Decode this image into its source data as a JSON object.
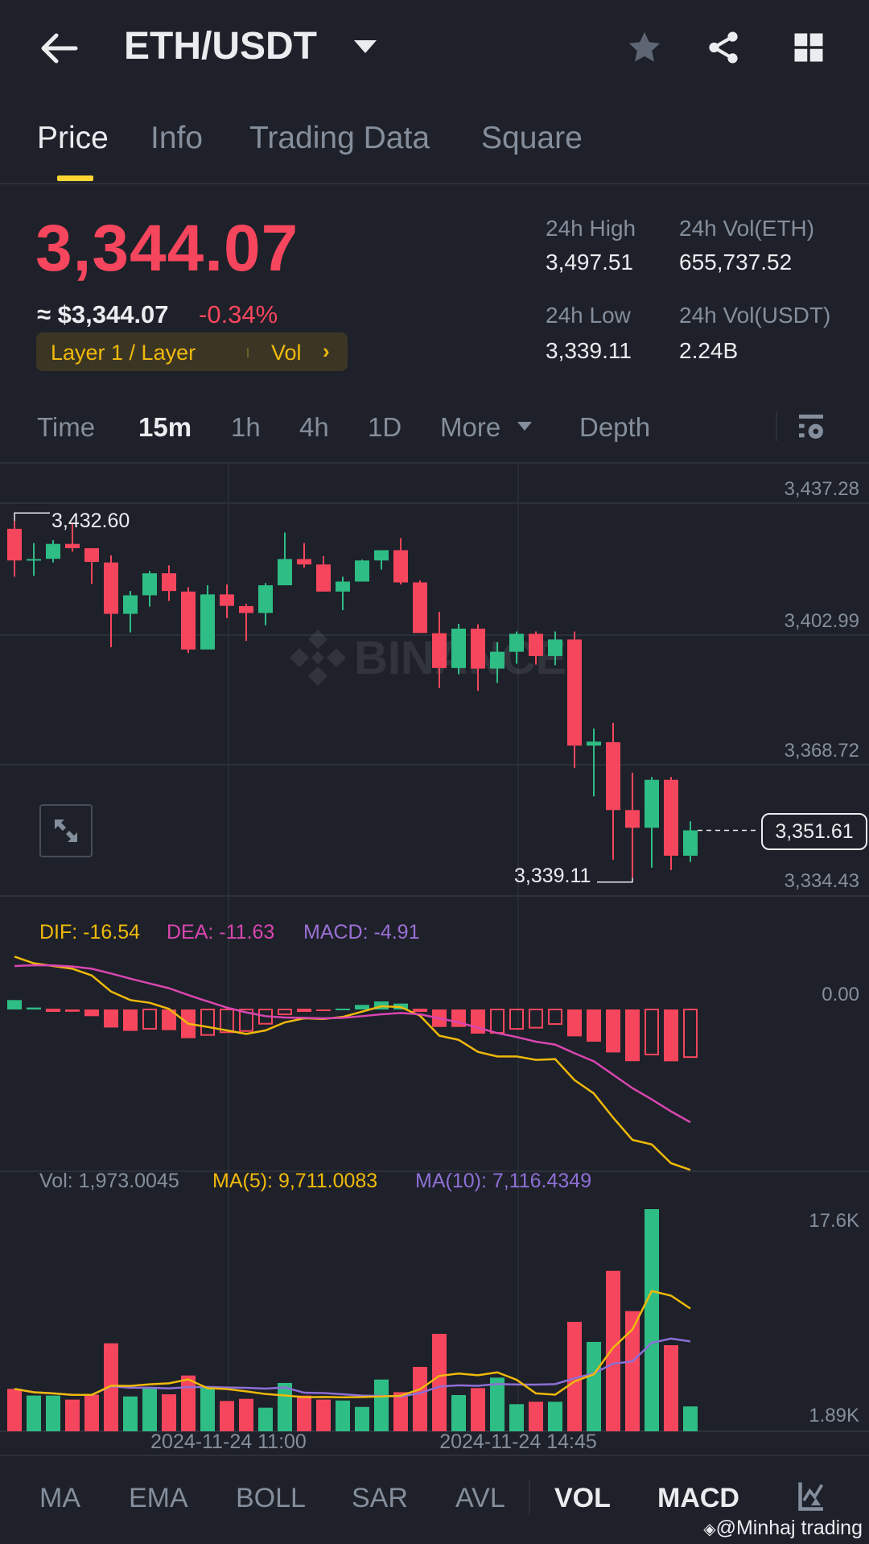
{
  "header": {
    "title": "ETH/USDT"
  },
  "tabs": [
    {
      "label": "Price"
    },
    {
      "label": "Info"
    },
    {
      "label": "Trading Data"
    },
    {
      "label": "Square"
    }
  ],
  "ticker": {
    "last_price": "3,344.07",
    "usd_price": "≈ $3,344.07",
    "change_pct": "-0.34%",
    "tag": "Layer 1 / Layer",
    "tag_link": "Vol",
    "high_label": "24h High",
    "high": "3,497.51",
    "low_label": "24h Low",
    "low": "3,339.11",
    "vol_base_label": "24h Vol(ETH)",
    "vol_base": "655,737.52",
    "vol_quote_label": "24h Vol(USDT)",
    "vol_quote": "2.24B"
  },
  "intervals": [
    {
      "label": "Time"
    },
    {
      "label": "15m"
    },
    {
      "label": "1h"
    },
    {
      "label": "4h"
    },
    {
      "label": "1D"
    },
    {
      "label": "More"
    },
    {
      "label": "Depth"
    }
  ],
  "colors": {
    "up": "#2ebd85",
    "down": "#f6465d",
    "dif": "#f0b90b",
    "dea": "#d946b0",
    "macd": "#9b6fd6",
    "ma5": "#f0b90b",
    "ma10": "#8e6fd6",
    "accent": "#fcd535"
  },
  "watermark": "BINANCE",
  "chart_data": {
    "type": "candlestick",
    "interval": "15m",
    "price_ticks": [
      "3,437.28",
      "3,402.99",
      "3,368.72",
      "3,334.43"
    ],
    "ylim": [
      3334.43,
      3437.28
    ],
    "max_label": "3,432.60",
    "max_index": 0,
    "min_label": "3,339.11",
    "min_index": 32,
    "current_price_label": "3,351.61",
    "current_price": 3351.61,
    "x_labels": [
      {
        "index": 11,
        "label": "2024-11-24 11:00"
      },
      {
        "index": 26,
        "label": "2024-11-24 14:45"
      }
    ],
    "candles": [
      [
        3430.56,
        3432.6,
        3418.01,
        3422.27
      ],
      [
        3422.27,
        3426.82,
        3418.23,
        3422.64
      ],
      [
        3422.71,
        3427.57,
        3421.74,
        3426.6
      ],
      [
        3426.6,
        3431.83,
        3424.58,
        3425.48
      ],
      [
        3425.48,
        3425.48,
        3416.14,
        3421.89
      ],
      [
        3421.74,
        3423.61,
        3399.56,
        3408.3
      ],
      [
        3408.3,
        3414.28,
        3403.45,
        3413.15
      ],
      [
        3413.15,
        3419.5,
        3410.17,
        3418.91
      ],
      [
        3418.91,
        3421.0,
        3411.66,
        3414.28
      ],
      [
        3414.13,
        3415.25,
        3398.07,
        3398.96
      ],
      [
        3398.96,
        3415.77,
        3398.96,
        3413.38
      ],
      [
        3413.38,
        3415.99,
        3407.18,
        3410.39
      ],
      [
        3410.32,
        3410.91,
        3401.21,
        3408.52
      ],
      [
        3408.52,
        3416.37,
        3405.31,
        3415.77
      ],
      [
        3415.77,
        3429.59,
        3415.77,
        3422.64
      ],
      [
        3422.64,
        3426.82,
        3420.4,
        3421.22
      ],
      [
        3421.22,
        3423.39,
        3414.13,
        3414.13
      ],
      [
        3414.13,
        3418.01,
        3409.27,
        3416.74
      ],
      [
        3416.74,
        3422.49,
        3416.74,
        3422.27
      ],
      [
        3422.27,
        3424.95,
        3419.88,
        3424.95
      ],
      [
        3424.95,
        3428.09,
        3415.99,
        3416.52
      ],
      [
        3416.52,
        3417.04,
        3403.3,
        3403.3
      ],
      [
        3403.22,
        3408.82,
        3388.88,
        3394.11
      ],
      [
        3394.11,
        3405.69,
        3392.47,
        3404.42
      ],
      [
        3404.42,
        3405.54,
        3388.14,
        3393.96
      ],
      [
        3393.96,
        3400.83,
        3390.23,
        3398.37
      ],
      [
        3398.37,
        3403.67,
        3395.23,
        3403.07
      ],
      [
        3403.07,
        3403.67,
        3395.01,
        3397.25
      ],
      [
        3397.25,
        3403.67,
        3394.86,
        3401.58
      ],
      [
        3401.58,
        3403.67,
        3367.97,
        3373.8
      ],
      [
        3373.8,
        3378.28,
        3360.5,
        3374.84
      ],
      [
        3374.69,
        3379.77,
        3343.92,
        3356.92
      ],
      [
        3356.92,
        3366.7,
        3339.11,
        3352.29
      ],
      [
        3352.29,
        3365.59,
        3341.83,
        3364.84
      ],
      [
        3364.84,
        3365.59,
        3341.23,
        3344.97
      ],
      [
        3344.97,
        3354.0,
        3343.33,
        3351.61
      ]
    ],
    "macd": {
      "legend": {
        "dif": "DIF: -16.54",
        "dea": "DEA: -11.63",
        "macd": "MACD: -4.91"
      },
      "zero_label": "0.00",
      "dif": [
        5.45,
        4.76,
        4.48,
        4.2,
        3.51,
        1.85,
        0.97,
        0.69,
        0.06,
        -1.47,
        -1.8,
        -2.16,
        -2.52,
        -2.16,
        -1.33,
        -0.91,
        -0.97,
        -0.77,
        -0.22,
        0.33,
        0.25,
        -0.64,
        -2.71,
        -3.13,
        -4.37,
        -4.84,
        -4.84,
        -5.2,
        -5.12,
        -7.28,
        -8.66,
        -11.15,
        -13.44,
        -13.91,
        -15.85,
        -16.54
      ],
      "dea": [
        4.48,
        4.56,
        4.54,
        4.43,
        4.2,
        3.71,
        3.18,
        2.68,
        2.19,
        1.49,
        0.83,
        0.19,
        -0.3,
        -0.69,
        -0.83,
        -0.86,
        -0.91,
        -0.86,
        -0.69,
        -0.5,
        -0.36,
        -0.5,
        -0.91,
        -1.33,
        -1.88,
        -2.43,
        -2.84,
        -3.32,
        -3.62,
        -4.51,
        -5.34,
        -6.72,
        -8.11,
        -9.27,
        -10.51,
        -11.63
      ]
    },
    "volume": {
      "legend": {
        "vol": "Vol: 1,973.0045",
        "ma5": "MA(5): 9,711.0083",
        "ma10": "MA(10): 7,116.4349"
      },
      "top_label": "17.6K",
      "bottom_label": "1.89K",
      "max": 17.6,
      "values_k": [
        3.36,
        2.83,
        2.83,
        2.51,
        2.9,
        6.97,
        2.76,
        3.46,
        2.93,
        4.42,
        3.51,
        2.4,
        2.57,
        1.87,
        3.83,
        2.83,
        2.51,
        2.44,
        1.93,
        4.1,
        3.1,
        5.1,
        7.72,
        2.87,
        3.42,
        4.25,
        2.15,
        2.34,
        2.34,
        8.67,
        7.08,
        12.71,
        9.52,
        17.6,
        6.82,
        1.97
      ]
    }
  },
  "indicator_tabs": [
    {
      "label": "MA"
    },
    {
      "label": "EMA"
    },
    {
      "label": "BOLL"
    },
    {
      "label": "SAR"
    },
    {
      "label": "AVL"
    },
    {
      "label": "VOL"
    },
    {
      "label": "MACD"
    }
  ],
  "credit": "@Minhaj trading"
}
